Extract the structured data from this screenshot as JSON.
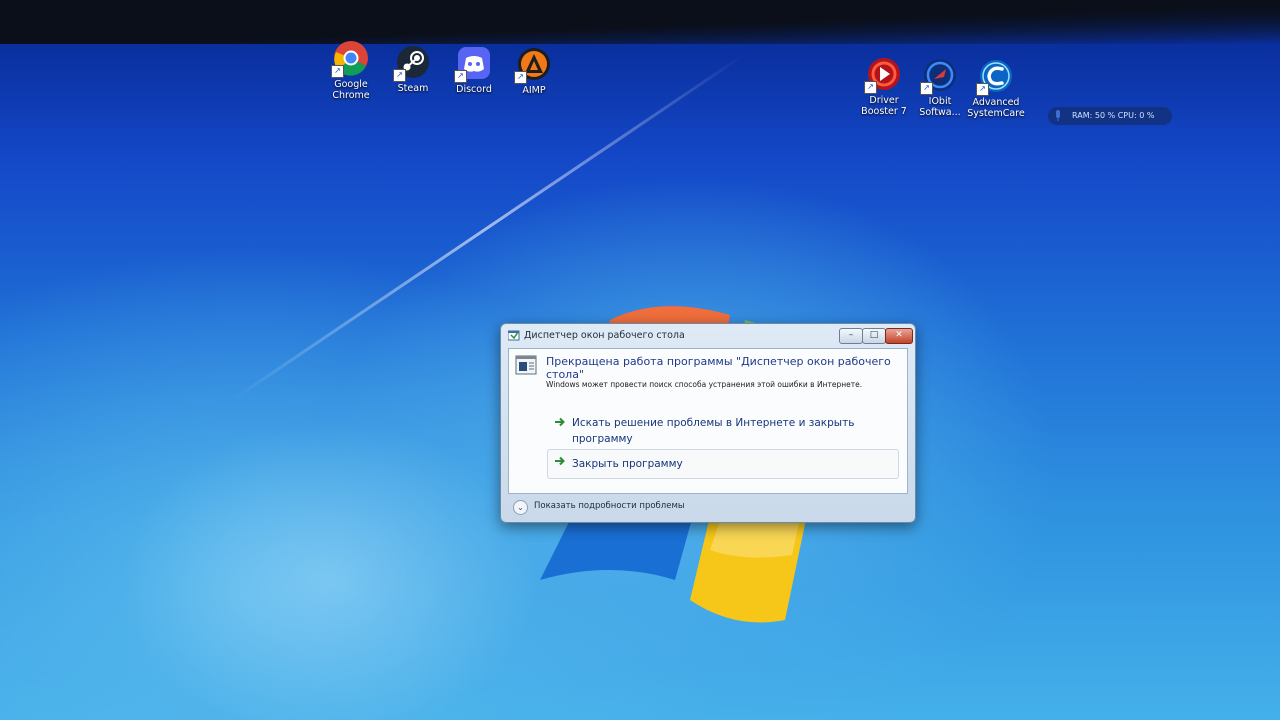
{
  "desktop": {
    "icons": [
      {
        "label": "Google Chrome",
        "icon": "chrome-icon"
      },
      {
        "label": "Steam",
        "icon": "steam-icon"
      },
      {
        "label": "Discord",
        "icon": "discord-icon"
      },
      {
        "label": "AIMP",
        "icon": "aimp-icon"
      },
      {
        "label": "Driver Booster 7",
        "icon": "driver-booster-icon"
      },
      {
        "label": "IObit Softwa...",
        "icon": "iobit-icon"
      },
      {
        "label": "Advanced SystemCare",
        "icon": "advanced-systemcare-icon"
      }
    ],
    "widget": {
      "text": "RAM: 50 %  CPU: 0 %"
    }
  },
  "dialog": {
    "title": "Диспетчер окон рабочего стола",
    "main_instruction": "Прекращена работа программы \"Диспетчер окон рабочего стола\"",
    "sub_text": "Windows может провести поиск способа устранения этой ошибки в Интернете.",
    "option_search": "Искать решение проблемы в Интернете и закрыть программу",
    "option_close": "Закрыть программу",
    "details_label": "Показать подробности проблемы",
    "buttons": {
      "minimize": "–",
      "maximize": "□",
      "close": "✕"
    }
  },
  "colors": {
    "desktop_blue": "#1f6fd6",
    "link_blue": "#15367a",
    "instruction_blue": "#1f3a8a",
    "arrow_green": "#2e8b3a"
  }
}
